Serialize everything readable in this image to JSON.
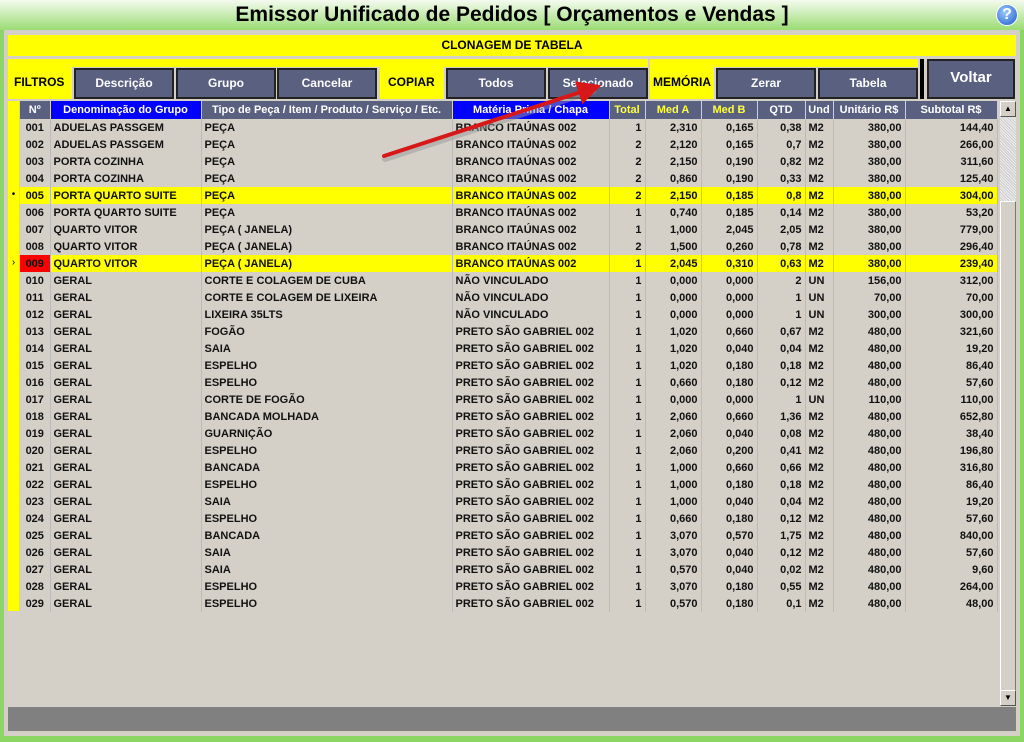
{
  "title": "Emissor Unificado de Pedidos [ Orçamentos e Vendas ]",
  "help_icon": "question-circle-icon",
  "banner": "CLONAGEM DE TABELA",
  "toolbar": {
    "filtros_label": "FILTROS",
    "descricao": "Descrição",
    "grupo": "Grupo",
    "cancelar": "Cancelar",
    "copiar_label": "COPIAR",
    "todos": "Todos",
    "selecionado": "Selecionado",
    "memoria_label": "MEMÓRIA",
    "zerar": "Zerar",
    "tabela": "Tabela",
    "voltar": "Voltar"
  },
  "colors": {
    "accent_yellow": "#ffff00",
    "button": "#5a6080",
    "header_blue": "#0000ff",
    "frame_green": "#8cd663",
    "current_cell": "#ff0000"
  },
  "table": {
    "columns": [
      "Nº",
      "Denominação do Grupo",
      "Tipo de Peça / Item / Produto / Serviço / Etc.",
      "Matéria Prima / Chapa",
      "Total",
      "Med A",
      "Med B",
      "QTD",
      "Und",
      "Unitário R$",
      "Subtotal R$"
    ],
    "selected_rows": [
      "005"
    ],
    "current_row": "009",
    "rows": [
      [
        "001",
        "ADUELAS PASSGEM",
        "PEÇA",
        "BRANCO ITAÚNAS 002",
        "1",
        "2,310",
        "0,165",
        "0,38",
        "M2",
        "380,00",
        "144,40"
      ],
      [
        "002",
        "ADUELAS PASSGEM",
        "PEÇA",
        "BRANCO ITAÚNAS 002",
        "2",
        "2,120",
        "0,165",
        "0,7",
        "M2",
        "380,00",
        "266,00"
      ],
      [
        "003",
        "PORTA COZINHA",
        "PEÇA",
        "BRANCO ITAÚNAS 002",
        "2",
        "2,150",
        "0,190",
        "0,82",
        "M2",
        "380,00",
        "311,60"
      ],
      [
        "004",
        "PORTA COZINHA",
        "PEÇA",
        "BRANCO ITAÚNAS 002",
        "2",
        "0,860",
        "0,190",
        "0,33",
        "M2",
        "380,00",
        "125,40"
      ],
      [
        "005",
        "PORTA QUARTO SUITE",
        "PEÇA",
        "BRANCO ITAÚNAS 002",
        "2",
        "2,150",
        "0,185",
        "0,8",
        "M2",
        "380,00",
        "304,00"
      ],
      [
        "006",
        "PORTA QUARTO SUITE",
        "PEÇA",
        "BRANCO ITAÚNAS 002",
        "1",
        "0,740",
        "0,185",
        "0,14",
        "M2",
        "380,00",
        "53,20"
      ],
      [
        "007",
        "QUARTO VITOR",
        "PEÇA  ( JANELA)",
        "BRANCO ITAÚNAS 002",
        "1",
        "1,000",
        "2,045",
        "2,05",
        "M2",
        "380,00",
        "779,00"
      ],
      [
        "008",
        "QUARTO VITOR",
        "PEÇA  ( JANELA)",
        "BRANCO ITAÚNAS 002",
        "2",
        "1,500",
        "0,260",
        "0,78",
        "M2",
        "380,00",
        "296,40"
      ],
      [
        "009",
        "QUARTO VITOR",
        "PEÇA  ( JANELA)",
        "BRANCO ITAÚNAS 002",
        "1",
        "2,045",
        "0,310",
        "0,63",
        "M2",
        "380,00",
        "239,40"
      ],
      [
        "010",
        "GERAL",
        "CORTE E COLAGEM DE CUBA",
        "NÃO VINCULADO",
        "1",
        "0,000",
        "0,000",
        "2",
        "UN",
        "156,00",
        "312,00"
      ],
      [
        "011",
        "GERAL",
        "CORTE E COLAGEM DE LIXEIRA",
        "NÃO VINCULADO",
        "1",
        "0,000",
        "0,000",
        "1",
        "UN",
        "70,00",
        "70,00"
      ],
      [
        "012",
        "GERAL",
        "LIXEIRA 35LTS",
        "NÃO VINCULADO",
        "1",
        "0,000",
        "0,000",
        "1",
        "UN",
        "300,00",
        "300,00"
      ],
      [
        "013",
        "GERAL",
        "FOGÃO",
        "PRETO SÃO GABRIEL 002",
        "1",
        "1,020",
        "0,660",
        "0,67",
        "M2",
        "480,00",
        "321,60"
      ],
      [
        "014",
        "GERAL",
        "SAIA",
        "PRETO SÃO GABRIEL 002",
        "1",
        "1,020",
        "0,040",
        "0,04",
        "M2",
        "480,00",
        "19,20"
      ],
      [
        "015",
        "GERAL",
        "ESPELHO",
        "PRETO SÃO GABRIEL 002",
        "1",
        "1,020",
        "0,180",
        "0,18",
        "M2",
        "480,00",
        "86,40"
      ],
      [
        "016",
        "GERAL",
        "ESPELHO",
        "PRETO SÃO GABRIEL 002",
        "1",
        "0,660",
        "0,180",
        "0,12",
        "M2",
        "480,00",
        "57,60"
      ],
      [
        "017",
        "GERAL",
        "CORTE DE FOGÃO",
        "PRETO SÃO GABRIEL 002",
        "1",
        "0,000",
        "0,000",
        "1",
        "UN",
        "110,00",
        "110,00"
      ],
      [
        "018",
        "GERAL",
        "BANCADA MOLHADA",
        "PRETO SÃO GABRIEL 002",
        "1",
        "2,060",
        "0,660",
        "1,36",
        "M2",
        "480,00",
        "652,80"
      ],
      [
        "019",
        "GERAL",
        "GUARNIÇÃO",
        "PRETO SÃO GABRIEL 002",
        "1",
        "2,060",
        "0,040",
        "0,08",
        "M2",
        "480,00",
        "38,40"
      ],
      [
        "020",
        "GERAL",
        "ESPELHO",
        "PRETO SÃO GABRIEL 002",
        "1",
        "2,060",
        "0,200",
        "0,41",
        "M2",
        "480,00",
        "196,80"
      ],
      [
        "021",
        "GERAL",
        "BANCADA",
        "PRETO SÃO GABRIEL 002",
        "1",
        "1,000",
        "0,660",
        "0,66",
        "M2",
        "480,00",
        "316,80"
      ],
      [
        "022",
        "GERAL",
        "ESPELHO",
        "PRETO SÃO GABRIEL 002",
        "1",
        "1,000",
        "0,180",
        "0,18",
        "M2",
        "480,00",
        "86,40"
      ],
      [
        "023",
        "GERAL",
        "SAIA",
        "PRETO SÃO GABRIEL 002",
        "1",
        "1,000",
        "0,040",
        "0,04",
        "M2",
        "480,00",
        "19,20"
      ],
      [
        "024",
        "GERAL",
        "ESPELHO",
        "PRETO SÃO GABRIEL 002",
        "1",
        "0,660",
        "0,180",
        "0,12",
        "M2",
        "480,00",
        "57,60"
      ],
      [
        "025",
        "GERAL",
        "BANCADA",
        "PRETO SÃO GABRIEL 002",
        "1",
        "3,070",
        "0,570",
        "1,75",
        "M2",
        "480,00",
        "840,00"
      ],
      [
        "026",
        "GERAL",
        "SAIA",
        "PRETO SÃO GABRIEL 002",
        "1",
        "3,070",
        "0,040",
        "0,12",
        "M2",
        "480,00",
        "57,60"
      ],
      [
        "027",
        "GERAL",
        "SAIA",
        "PRETO SÃO GABRIEL 002",
        "1",
        "0,570",
        "0,040",
        "0,02",
        "M2",
        "480,00",
        "9,60"
      ],
      [
        "028",
        "GERAL",
        "ESPELHO",
        "PRETO SÃO GABRIEL 002",
        "1",
        "3,070",
        "0,180",
        "0,55",
        "M2",
        "480,00",
        "264,00"
      ],
      [
        "029",
        "GERAL",
        "ESPELHO",
        "PRETO SÃO GABRIEL 002",
        "1",
        "0,570",
        "0,180",
        "0,1",
        "M2",
        "480,00",
        "48,00"
      ]
    ]
  }
}
